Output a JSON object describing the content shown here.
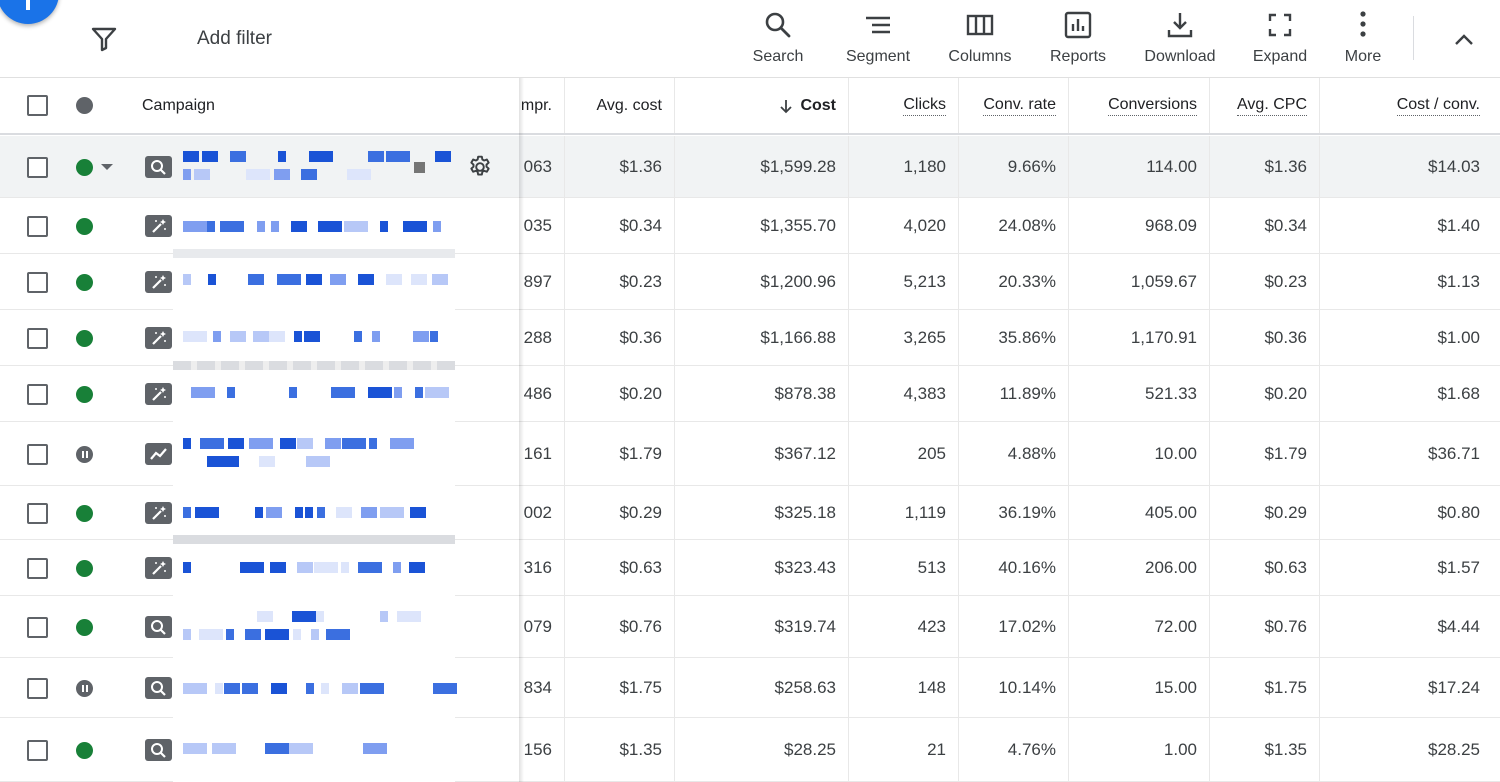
{
  "toolbar": {
    "add_filter": "Add filter",
    "tools": [
      {
        "label": "Search",
        "icon": "search-icon"
      },
      {
        "label": "Segment",
        "icon": "segment-icon"
      },
      {
        "label": "Columns",
        "icon": "columns-icon"
      },
      {
        "label": "Reports",
        "icon": "reports-icon"
      },
      {
        "label": "Download",
        "icon": "download-icon"
      },
      {
        "label": "Expand",
        "icon": "expand-icon"
      },
      {
        "label": "More",
        "icon": "more-icon"
      }
    ]
  },
  "table": {
    "columns": {
      "campaign": "Campaign",
      "impr": "mpr.",
      "avg_cost": "Avg. cost",
      "cost": "Cost",
      "clicks": "Clicks",
      "conv_rate": "Conv. rate",
      "conversions": "Conversions",
      "avg_cpc": "Avg. CPC",
      "cost_conv": "Cost / conv."
    },
    "sort": {
      "column": "Cost",
      "direction": "descending"
    },
    "colors": {
      "enabled": "#188038",
      "paused": "#5f6368",
      "accent": "#1a73e8"
    },
    "rows": [
      {
        "status": "enabled",
        "type": "search",
        "impr": "063",
        "avg_cost": "$1.36",
        "cost": "$1,599.28",
        "clicks": "1,180",
        "conv_rate": "9.66%",
        "conversions": "114.00",
        "avg_cpc": "$1.36",
        "cost_conv": "$14.03"
      },
      {
        "status": "enabled",
        "type": "performance-max",
        "impr": "035",
        "avg_cost": "$0.34",
        "cost": "$1,355.70",
        "clicks": "4,020",
        "conv_rate": "24.08%",
        "conversions": "968.09",
        "avg_cpc": "$0.34",
        "cost_conv": "$1.40"
      },
      {
        "status": "enabled",
        "type": "performance-max",
        "impr": "897",
        "avg_cost": "$0.23",
        "cost": "$1,200.96",
        "clicks": "5,213",
        "conv_rate": "20.33%",
        "conversions": "1,059.67",
        "avg_cpc": "$0.23",
        "cost_conv": "$1.13"
      },
      {
        "status": "enabled",
        "type": "performance-max",
        "impr": "288",
        "avg_cost": "$0.36",
        "cost": "$1,166.88",
        "clicks": "3,265",
        "conv_rate": "35.86%",
        "conversions": "1,170.91",
        "avg_cpc": "$0.36",
        "cost_conv": "$1.00"
      },
      {
        "status": "enabled",
        "type": "performance-max",
        "impr": "486",
        "avg_cost": "$0.20",
        "cost": "$878.38",
        "clicks": "4,383",
        "conv_rate": "11.89%",
        "conversions": "521.33",
        "avg_cpc": "$0.20",
        "cost_conv": "$1.68"
      },
      {
        "status": "paused",
        "type": "display",
        "impr": "161",
        "avg_cost": "$1.79",
        "cost": "$367.12",
        "clicks": "205",
        "conv_rate": "4.88%",
        "conversions": "10.00",
        "avg_cpc": "$1.79",
        "cost_conv": "$36.71"
      },
      {
        "status": "enabled",
        "type": "performance-max",
        "impr": "002",
        "avg_cost": "$0.29",
        "cost": "$325.18",
        "clicks": "1,119",
        "conv_rate": "36.19%",
        "conversions": "405.00",
        "avg_cpc": "$0.29",
        "cost_conv": "$0.80"
      },
      {
        "status": "enabled",
        "type": "performance-max",
        "impr": "316",
        "avg_cost": "$0.63",
        "cost": "$323.43",
        "clicks": "513",
        "conv_rate": "40.16%",
        "conversions": "206.00",
        "avg_cpc": "$0.63",
        "cost_conv": "$1.57"
      },
      {
        "status": "enabled",
        "type": "search",
        "impr": "079",
        "avg_cost": "$0.76",
        "cost": "$319.74",
        "clicks": "423",
        "conv_rate": "17.02%",
        "conversions": "72.00",
        "avg_cpc": "$0.76",
        "cost_conv": "$4.44"
      },
      {
        "status": "paused",
        "type": "search",
        "impr": "834",
        "avg_cost": "$1.75",
        "cost": "$258.63",
        "clicks": "148",
        "conv_rate": "10.14%",
        "conversions": "15.00",
        "avg_cpc": "$1.75",
        "cost_conv": "$17.24"
      },
      {
        "status": "enabled",
        "type": "search",
        "impr": "156",
        "avg_cost": "$1.35",
        "cost": "$28.25",
        "clicks": "21",
        "conv_rate": "4.76%",
        "conversions": "1.00",
        "avg_cpc": "$1.35",
        "cost_conv": "$28.25"
      }
    ]
  }
}
